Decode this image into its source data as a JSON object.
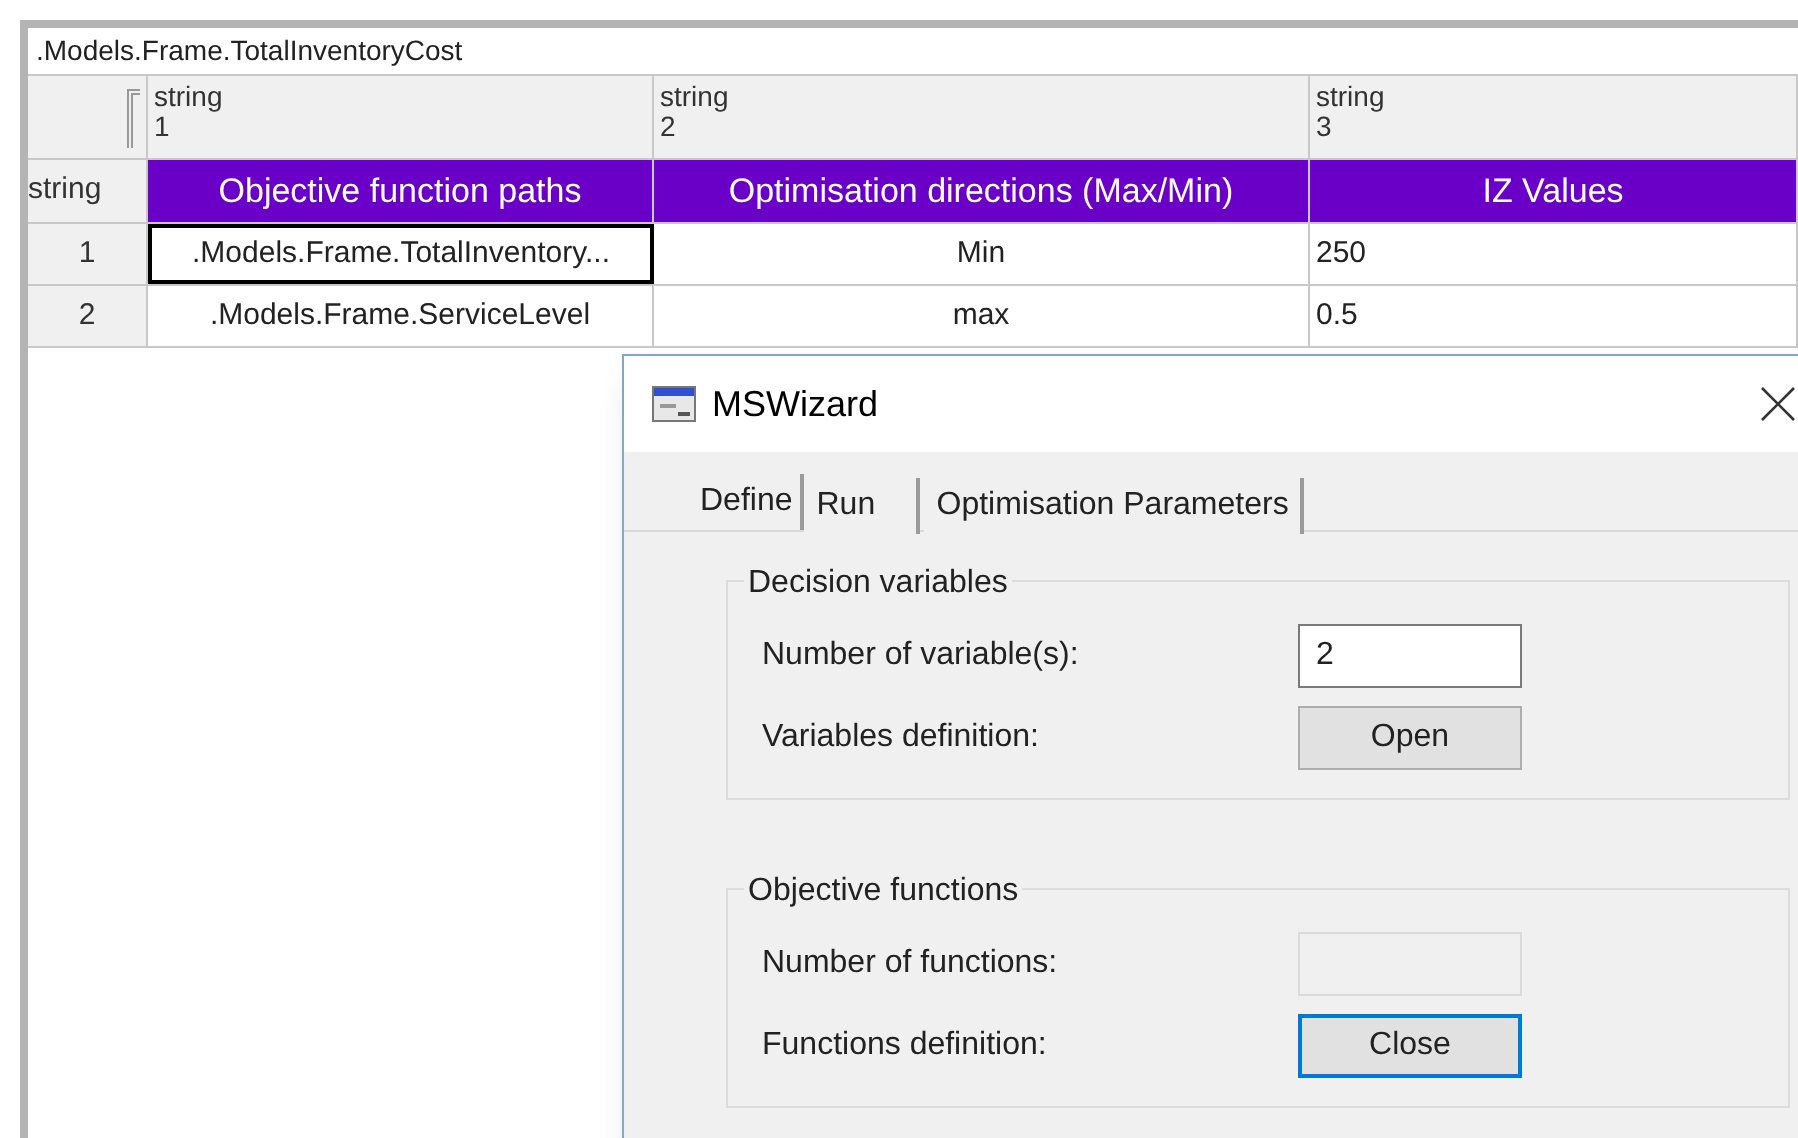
{
  "formula_bar": {
    "value": ".Models.Frame.TotalInventoryCost"
  },
  "table": {
    "corner_label": "string",
    "columns": [
      {
        "type": "string",
        "index": "1",
        "heading": "Objective function paths"
      },
      {
        "type": "string",
        "index": "2",
        "heading": "Optimisation directions (Max/Min)"
      },
      {
        "type": "string",
        "index": "3",
        "heading": "IZ Values"
      }
    ],
    "rows": [
      {
        "number": "1",
        "cells": [
          {
            "text": ".Models.Frame.TotalInventory...",
            "selected": true
          },
          {
            "text": "Min",
            "selected": false
          },
          {
            "text": "250",
            "selected": false
          }
        ]
      },
      {
        "number": "2",
        "cells": [
          {
            "text": ".Models.Frame.ServiceLevel",
            "selected": false
          },
          {
            "text": "max",
            "selected": false
          },
          {
            "text": "0.5",
            "selected": false
          }
        ]
      }
    ]
  },
  "dialog": {
    "title": "MSWizard",
    "tabs": [
      {
        "label": "Define",
        "selected": true
      },
      {
        "label": "Run",
        "selected": false
      },
      {
        "label": "Optimisation Parameters",
        "selected": false
      }
    ],
    "groups": [
      {
        "title": "Decision variables",
        "rows": [
          {
            "kind": "field",
            "label": "Number of variable(s):",
            "value": "2",
            "disabled": false
          },
          {
            "kind": "button",
            "label": "Variables definition:",
            "button": "Open",
            "focused": false
          }
        ]
      },
      {
        "title": "Objective functions",
        "rows": [
          {
            "kind": "field",
            "label": "Number of functions:",
            "disabled": true
          },
          {
            "kind": "button",
            "label": "Functions definition:",
            "button": "Close",
            "focused": true
          }
        ]
      }
    ]
  }
}
